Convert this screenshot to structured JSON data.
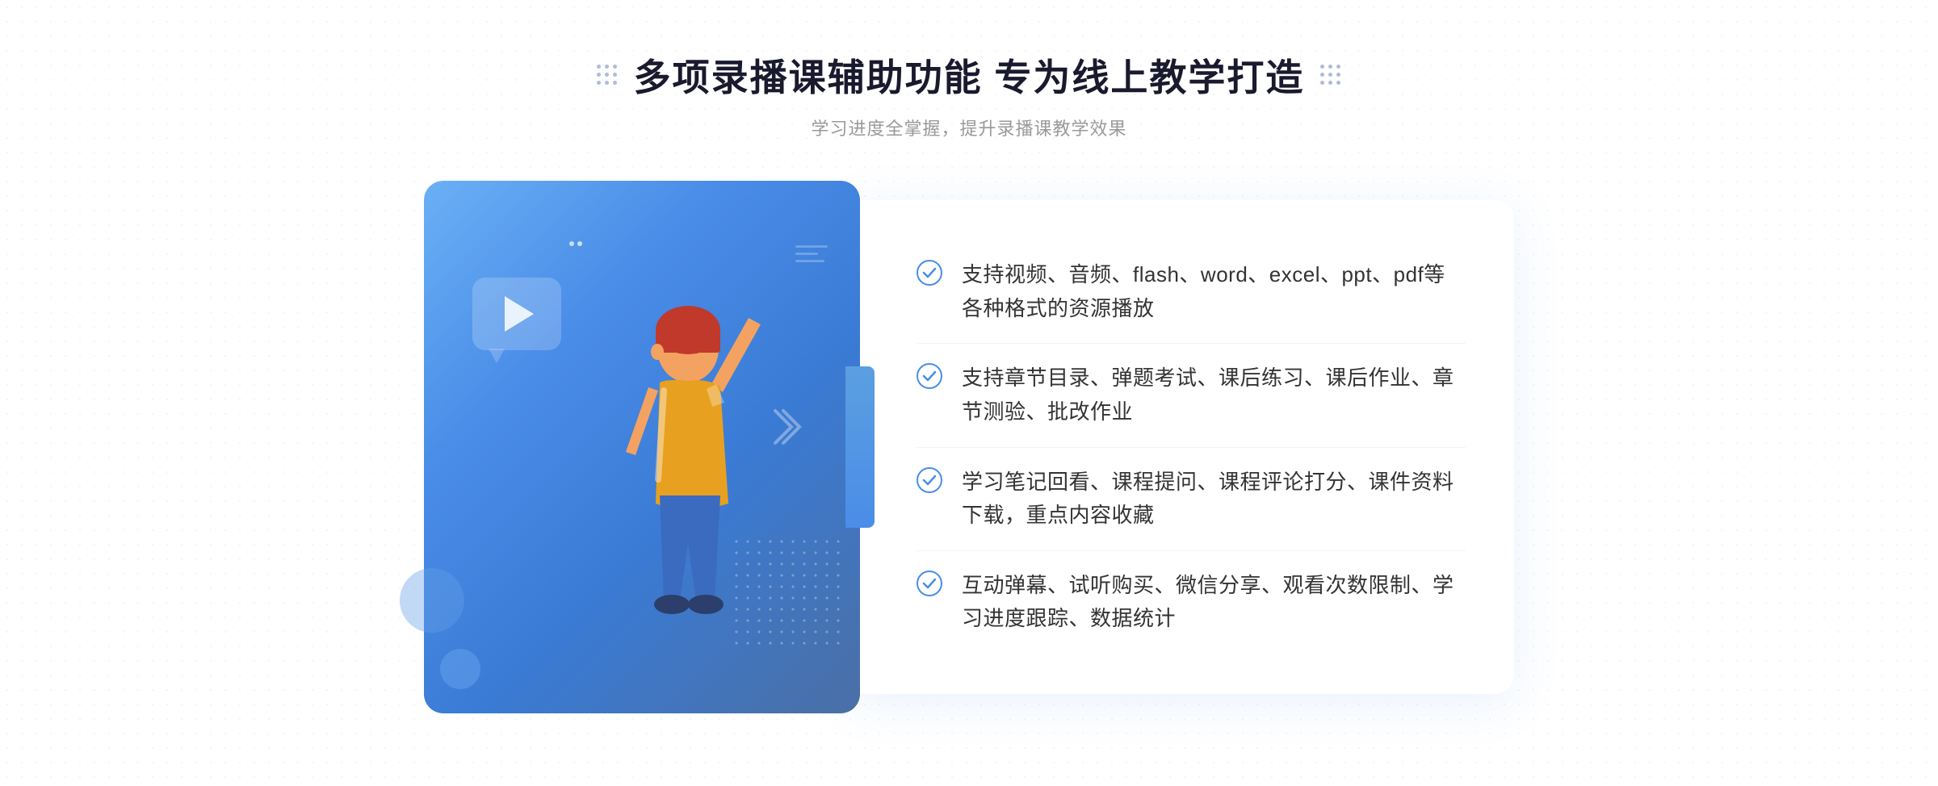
{
  "header": {
    "main_title": "多项录播课辅助功能 专为线上教学打造",
    "sub_title": "学习进度全掌握，提升录播课教学效果"
  },
  "features": [
    {
      "id": 1,
      "text": "支持视频、音频、flash、word、excel、ppt、pdf等各种格式的资源播放"
    },
    {
      "id": 2,
      "text": "支持章节目录、弹题考试、课后练习、课后作业、章节测验、批改作业"
    },
    {
      "id": 3,
      "text": "学习笔记回看、课程提问、课程评论打分、课件资料下载，重点内容收藏"
    },
    {
      "id": 4,
      "text": "互动弹幕、试听购买、微信分享、观看次数限制、学习进度跟踪、数据统计"
    }
  ],
  "decoration": {
    "left_chevrons": "»",
    "dots_label": "decorative-dots"
  }
}
